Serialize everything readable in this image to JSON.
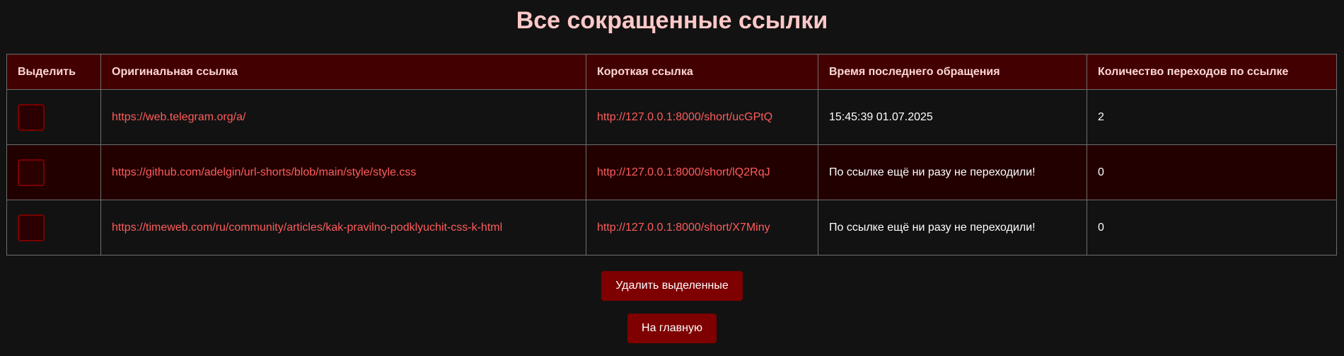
{
  "page": {
    "title": "Все сокращенные ссылки"
  },
  "table": {
    "headers": {
      "select": "Выделить",
      "original": "Оригинальная ссылка",
      "short": "Короткая ссылка",
      "last_access": "Время последнего обращения",
      "clicks": "Количество переходов по ссылке"
    },
    "rows": [
      {
        "selected": false,
        "original": "https://web.telegram.org/a/",
        "short": "http://127.0.0.1:8000/short/ucGPtQ",
        "last_access": "15:45:39 01.07.2025",
        "clicks": "2"
      },
      {
        "selected": false,
        "original": "https://github.com/adelgin/url-shorts/blob/main/style/style.css",
        "short": "http://127.0.0.1:8000/short/lQ2RqJ",
        "last_access": "По ссылке ещё ни разу не переходили!",
        "clicks": "0"
      },
      {
        "selected": false,
        "original": "https://timeweb.com/ru/community/articles/kak-pravilno-podklyuchit-css-k-html",
        "short": "http://127.0.0.1:8000/short/X7Miny",
        "last_access": "По ссылке ещё ни разу не переходили!",
        "clicks": "0"
      }
    ]
  },
  "actions": {
    "delete_label": "Удалить выделенные",
    "home_label": "На главную"
  },
  "colors": {
    "background": "#121212",
    "title": "#ffc8c8",
    "header_bg": "#420000",
    "row_alt_bg": "#220000",
    "link": "#ff5c5c",
    "button_bg": "#7f0000"
  }
}
